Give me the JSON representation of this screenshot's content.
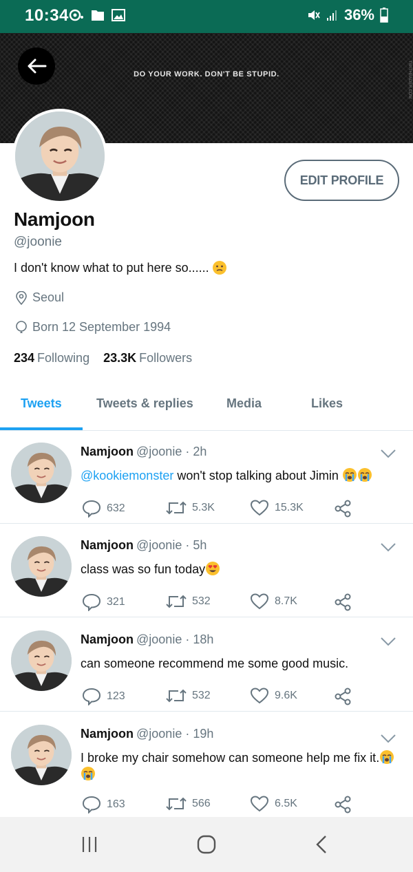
{
  "status_bar": {
    "time": "10:34",
    "battery": "36%",
    "left_icons": [
      "notification-icon",
      "folder-icon",
      "image-icon"
    ],
    "right_icons": [
      "mute-icon",
      "signal-icon",
      "battery-icon"
    ],
    "bg_color": "#0b6b55"
  },
  "header": {
    "banner_text": "DO YOUR WORK. DON'T BE STUPID.",
    "banner_credit": "TWITHEADER.COM",
    "back_icon": "back-arrow-icon"
  },
  "profile": {
    "edit_label": "EDIT PROFILE",
    "name": "Namjoon",
    "handle": "@joonie",
    "bio": "I don't know what to put here so......",
    "bio_emoji": "confused-face-emoji",
    "location": "Seoul",
    "birthday": "Born 12 September 1994",
    "following_count": "234",
    "following_label": "Following",
    "followers_count": "23.3K",
    "followers_label": "Followers"
  },
  "tabs": [
    "Tweets",
    "Tweets & replies",
    "Media",
    "Likes"
  ],
  "active_tab": "Tweets",
  "accent_color": "#1da1f2",
  "tweets": [
    {
      "name": "Namjoon",
      "handle": "@joonie",
      "time": "· 2h",
      "mention": "@kookiemonster",
      "text": " won't stop talking about Jimin",
      "emojis": [
        "loudly-crying-face-emoji",
        "loudly-crying-face-emoji"
      ],
      "replies": "632",
      "retweets": "5.3K",
      "likes": "15.3K"
    },
    {
      "name": "Namjoon",
      "handle": "@joonie",
      "time": "· 5h",
      "text": "class was so fun today",
      "emojis": [
        "heart-eyes-emoji"
      ],
      "replies": "321",
      "retweets": "532",
      "likes": "8.7K"
    },
    {
      "name": "Namjoon",
      "handle": "@joonie",
      "time": "· 18h",
      "text": "can someone recommend me some good music.",
      "emojis": [],
      "replies": "123",
      "retweets": "532",
      "likes": "9.6K"
    },
    {
      "name": "Namjoon",
      "handle": "@joonie",
      "time": "· 19h",
      "text": "I broke my chair somehow can someone help me fix it.",
      "emojis": [
        "loudly-crying-face-emoji",
        "loudly-crying-face-emoji"
      ],
      "replies": "163",
      "retweets": "566",
      "likes": "6.5K"
    }
  ],
  "nav_bar": [
    "recent-apps-icon",
    "home-icon",
    "back-icon"
  ]
}
